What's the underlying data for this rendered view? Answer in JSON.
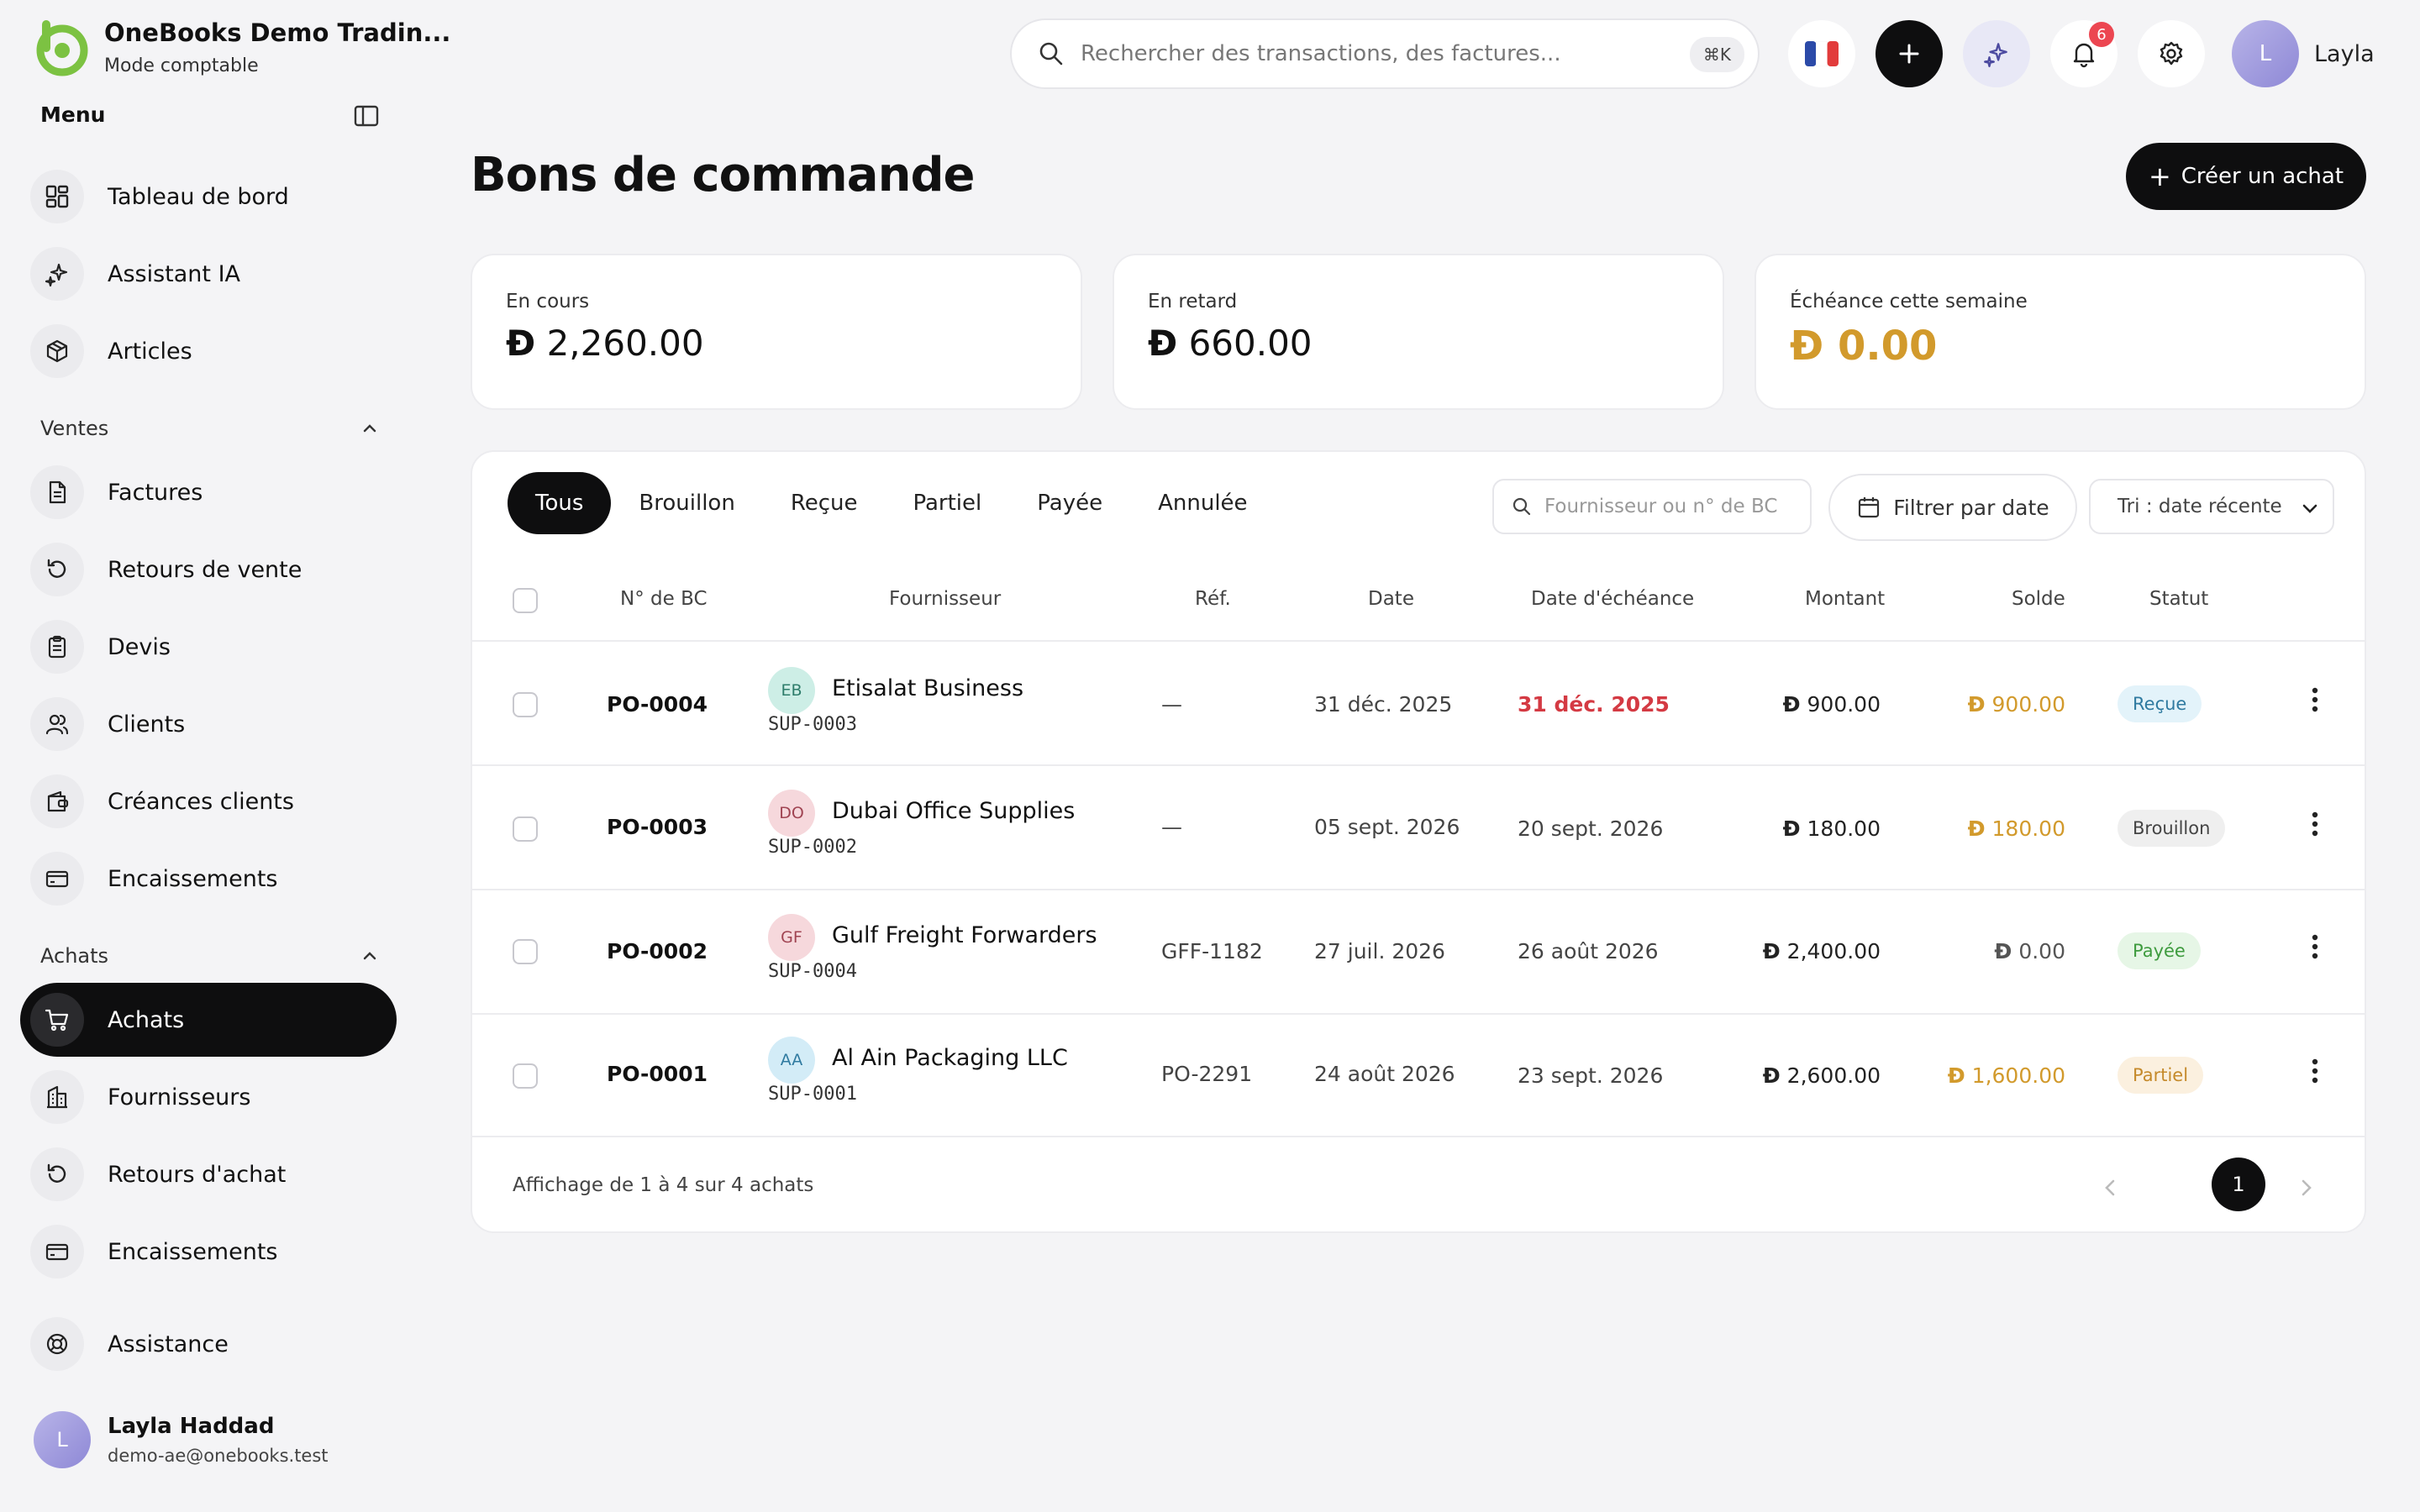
{
  "brand": {
    "name": "OneBooks Demo Tradin...",
    "mode": "Mode comptable"
  },
  "sidebar": {
    "menu_title": "Menu",
    "top_items": [
      {
        "label": "Tableau de bord",
        "icon": "dashboard-icon"
      },
      {
        "label": "Assistant IA",
        "icon": "sparkles-icon"
      },
      {
        "label": "Articles",
        "icon": "box-icon"
      }
    ],
    "sales_title": "Ventes",
    "sales_items": [
      {
        "label": "Factures",
        "icon": "invoice-icon"
      },
      {
        "label": "Retours de vente",
        "icon": "return-icon"
      },
      {
        "label": "Devis",
        "icon": "clipboard-icon"
      },
      {
        "label": "Clients",
        "icon": "users-icon"
      },
      {
        "label": "Créances clients",
        "icon": "wallet-icon"
      },
      {
        "label": "Encaissements",
        "icon": "card-icon"
      }
    ],
    "purchases_title": "Achats",
    "purchases_items": [
      {
        "label": "Achats",
        "icon": "cart-icon",
        "active": true
      },
      {
        "label": "Fournisseurs",
        "icon": "building-icon"
      },
      {
        "label": "Retours d'achat",
        "icon": "return-icon"
      },
      {
        "label": "Encaissements",
        "icon": "card-icon"
      }
    ],
    "support": {
      "label": "Assistance",
      "icon": "lifebuoy-icon"
    },
    "user": {
      "initial": "L",
      "name": "Layla Haddad",
      "email": "demo-ae@onebooks.test"
    }
  },
  "topbar": {
    "search_placeholder": "Rechercher des transactions, des factures...",
    "shortcut": "⌘K",
    "notifications_count": "6",
    "user_initial": "L",
    "user_name": "Layla"
  },
  "page": {
    "title": "Bons de commande",
    "create_label": "Créer un achat"
  },
  "currency_symbol": "Đ",
  "stats": [
    {
      "label": "En cours",
      "value": "2,260.00"
    },
    {
      "label": "En retard",
      "value": "660.00"
    },
    {
      "label": "Échéance cette semaine",
      "value": "0.00"
    }
  ],
  "filters": {
    "tabs": [
      "Tous",
      "Brouillon",
      "Reçue",
      "Partiel",
      "Payée",
      "Annulée"
    ],
    "active_tab": "Tous",
    "search_placeholder": "Fournisseur ou n° de BC",
    "date_filter": "Filtrer par date",
    "sort": "Tri : date récente"
  },
  "table": {
    "headers": {
      "number": "N° de BC",
      "supplier": "Fournisseur",
      "ref": "Réf.",
      "date": "Date",
      "due": "Date d'échéance",
      "amount": "Montant",
      "balance": "Solde",
      "status": "Statut"
    },
    "rows": [
      {
        "number": "PO-0004",
        "initials": "EB",
        "supplier": "Etisalat Business",
        "code": "SUP-0003",
        "ref": "—",
        "date": "31 déc. 2025",
        "due": "31 déc. 2025",
        "due_overdue": true,
        "amount": "900.00",
        "balance": "900.00",
        "status": "Reçue"
      },
      {
        "number": "PO-0003",
        "initials": "DO",
        "supplier": "Dubai Office Supplies",
        "code": "SUP-0002",
        "ref": "—",
        "date": "05 sept. 2026",
        "due": "20 sept. 2026",
        "due_overdue": false,
        "amount": "180.00",
        "balance": "180.00",
        "status": "Brouillon"
      },
      {
        "number": "PO-0002",
        "initials": "GF",
        "supplier": "Gulf Freight Forwarders",
        "code": "SUP-0004",
        "ref": "GFF-1182",
        "date": "27 juil. 2026",
        "due": "26 août 2026",
        "due_overdue": false,
        "amount": "2,400.00",
        "balance": "0.00",
        "status": "Payée"
      },
      {
        "number": "PO-0001",
        "initials": "AA",
        "supplier": "Al Ain Packaging LLC",
        "code": "SUP-0001",
        "ref": "PO-2291",
        "date": "24 août 2026",
        "due": "23 sept. 2026",
        "due_overdue": false,
        "amount": "2,600.00",
        "balance": "1,600.00",
        "status": "Partiel"
      }
    ],
    "footer": "Affichage de 1 à 4 sur 4 achats",
    "current_page": "1"
  },
  "colors": {
    "dark": "#0e0e0f",
    "gold": "#d29a2c",
    "overdue": "#d43a43",
    "received_bg": "#e3f3fa",
    "received_fg": "#2f7aa0",
    "draft_bg": "#efefef",
    "draft_fg": "#444444",
    "paid_bg": "#e6f6e6",
    "paid_fg": "#3e9b3e",
    "partial_bg": "#fbf0df",
    "partial_fg": "#c58a2b"
  }
}
